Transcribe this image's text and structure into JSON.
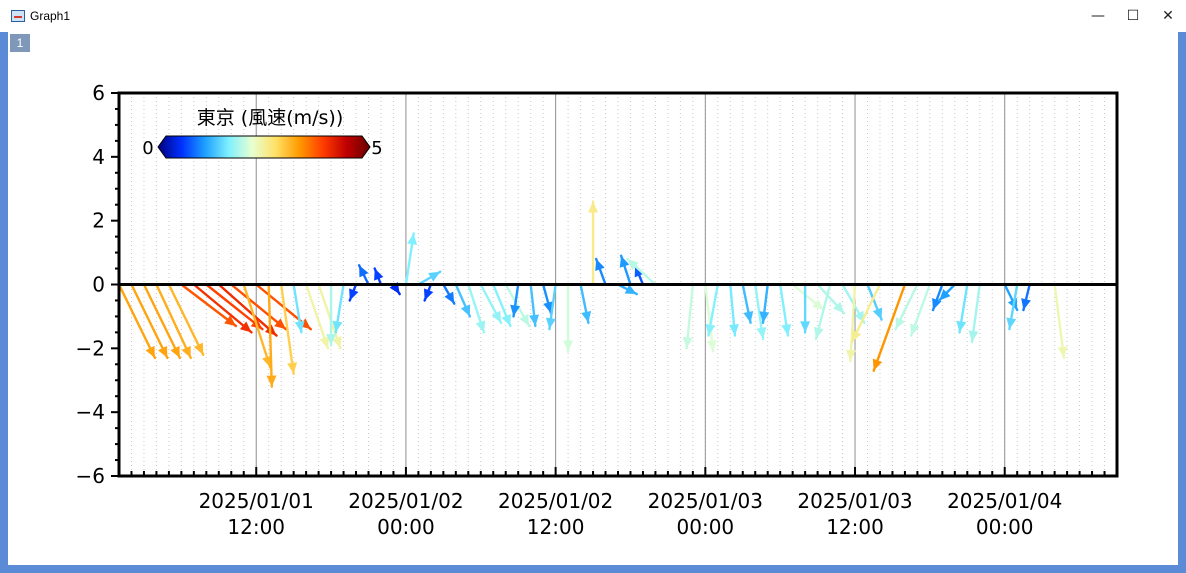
{
  "window": {
    "title": "Graph1",
    "layer_label": "1",
    "minimize": "—",
    "maximize": "☐",
    "close": "✕"
  },
  "chart_data": {
    "type": "vector",
    "title": "",
    "xlabel": "",
    "ylabel": "",
    "x_axis": {
      "ticks": [
        "2025/01/01\n12:00",
        "2025/01/02\n00:00",
        "2025/01/02\n12:00",
        "2025/01/03\n00:00",
        "2025/01/03\n12:00",
        "2025/01/04\n00:00"
      ],
      "tick_hours": [
        12,
        24,
        36,
        48,
        60,
        72
      ],
      "range_hours": [
        1,
        81
      ],
      "minor_step_hours": 1
    },
    "y_axis": {
      "range": [
        -6,
        6
      ],
      "ticks": [
        -6,
        -4,
        -2,
        0,
        2,
        4,
        6
      ],
      "minor_step": 0.5
    },
    "grid": true,
    "colormap": {
      "title": "東京 (風速(m/s))",
      "min_label": "0",
      "max_label": "5",
      "range": [
        0,
        5
      ],
      "colors": [
        "#00007f",
        "#0030ff",
        "#1ea0ff",
        "#7ff0ff",
        "#e8ffd0",
        "#ffe066",
        "#ff9a00",
        "#ff3c00",
        "#c00000",
        "#6a0000"
      ],
      "placement": "top-left"
    },
    "vectors": [
      {
        "t": 1,
        "u": 2.3,
        "v": -2.3
      },
      {
        "t": 2,
        "u": 2.3,
        "v": -2.3
      },
      {
        "t": 3,
        "u": 2.3,
        "v": -2.3
      },
      {
        "t": 4,
        "u": 2.2,
        "v": -2.3
      },
      {
        "t": 5,
        "u": 2.2,
        "v": -2.2
      },
      {
        "t": 6,
        "u": 3.5,
        "v": -1.3
      },
      {
        "t": 7,
        "u": 3.7,
        "v": -1.5
      },
      {
        "t": 8,
        "u": 3.6,
        "v": -1.4
      },
      {
        "t": 9,
        "u": 3.7,
        "v": -1.6
      },
      {
        "t": 10,
        "u": 3.5,
        "v": -1.4
      },
      {
        "t": 11,
        "u": 1.7,
        "v": -2.6
      },
      {
        "t": 12,
        "u": 3.5,
        "v": -1.4
      },
      {
        "t": 13,
        "u": 0.2,
        "v": -3.2
      },
      {
        "t": 14,
        "u": 0.8,
        "v": -2.8
      },
      {
        "t": 15,
        "u": 0.5,
        "v": -1.5
      },
      {
        "t": 16,
        "u": 1.4,
        "v": -2.0
      },
      {
        "t": 17,
        "u": 1.4,
        "v": -2.0
      },
      {
        "t": 18,
        "u": 0.0,
        "v": -1.9
      },
      {
        "t": 19,
        "u": -0.5,
        "v": -1.5
      },
      {
        "t": 20,
        "u": -0.4,
        "v": -0.5
      },
      {
        "t": 21,
        "u": -0.6,
        "v": 0.6
      },
      {
        "t": 22,
        "u": -0.4,
        "v": 0.5
      },
      {
        "t": 23,
        "u": 0.4,
        "v": -0.3
      },
      {
        "t": 24,
        "u": 0.5,
        "v": 1.6
      },
      {
        "t": 25,
        "u": 1.4,
        "v": 0.4
      },
      {
        "t": 26,
        "u": -0.4,
        "v": -0.5
      },
      {
        "t": 27,
        "u": 0.7,
        "v": -0.6
      },
      {
        "t": 28,
        "u": 0.9,
        "v": -1.0
      },
      {
        "t": 29,
        "u": 1.0,
        "v": -1.5
      },
      {
        "t": 30,
        "u": 1.3,
        "v": -1.2
      },
      {
        "t": 31,
        "u": 1.1,
        "v": -1.3
      },
      {
        "t": 32,
        "u": 1.5,
        "v": -1.3
      },
      {
        "t": 33,
        "u": -0.3,
        "v": -1.0
      },
      {
        "t": 34,
        "u": 0.3,
        "v": -1.3
      },
      {
        "t": 35,
        "u": 0.5,
        "v": -0.9
      },
      {
        "t": 36,
        "u": -0.4,
        "v": -1.4
      },
      {
        "t": 37,
        "u": 0.0,
        "v": -2.1
      },
      {
        "t": 38,
        "u": 0.5,
        "v": -1.2
      },
      {
        "t": 39,
        "u": 0.0,
        "v": 2.6
      },
      {
        "t": 40,
        "u": -0.6,
        "v": 0.8
      },
      {
        "t": 41,
        "u": 1.2,
        "v": -0.3
      },
      {
        "t": 42,
        "u": -0.6,
        "v": 0.9
      },
      {
        "t": 43,
        "u": -0.5,
        "v": 0.6
      },
      {
        "t": 44,
        "u": -1.8,
        "v": 0.8
      },
      {
        "t": 45,
        "u": 0.0,
        "v": 0.0
      },
      {
        "t": 46,
        "u": 0.0,
        "v": 0.0
      },
      {
        "t": 47,
        "u": -0.4,
        "v": -2.0
      },
      {
        "t": 48,
        "u": 0.5,
        "v": -2.1
      },
      {
        "t": 49,
        "u": -0.6,
        "v": -1.6
      },
      {
        "t": 50,
        "u": 0.3,
        "v": -1.6
      },
      {
        "t": 51,
        "u": 0.5,
        "v": -1.2
      },
      {
        "t": 52,
        "u": 0.5,
        "v": -1.7
      },
      {
        "t": 53,
        "u": -0.3,
        "v": -1.2
      },
      {
        "t": 54,
        "u": 0.5,
        "v": -1.6
      },
      {
        "t": 55,
        "u": 2.0,
        "v": -0.8
      },
      {
        "t": 56,
        "u": 0.0,
        "v": -1.5
      },
      {
        "t": 57,
        "u": 1.7,
        "v": -0.9
      },
      {
        "t": 58,
        "u": -0.9,
        "v": -1.7
      },
      {
        "t": 59,
        "u": 1.4,
        "v": -1.2
      },
      {
        "t": 60,
        "u": -0.3,
        "v": -2.4
      },
      {
        "t": 61,
        "u": 0.9,
        "v": -1.1
      },
      {
        "t": 62,
        "u": -1.8,
        "v": -1.8
      },
      {
        "t": 63,
        "u": 0.0,
        "v": 0.0
      },
      {
        "t": 64,
        "u": -2.0,
        "v": -2.7
      },
      {
        "t": 65,
        "u": -1.4,
        "v": -1.4
      },
      {
        "t": 66,
        "u": -1.2,
        "v": -1.6
      },
      {
        "t": 67,
        "u": -0.6,
        "v": -0.8
      },
      {
        "t": 68,
        "u": -1.0,
        "v": -0.5
      },
      {
        "t": 69,
        "u": -0.5,
        "v": -1.5
      },
      {
        "t": 70,
        "u": -0.5,
        "v": -1.8
      },
      {
        "t": 71,
        "u": 0.0,
        "v": 0.0
      },
      {
        "t": 72,
        "u": 0.8,
        "v": -0.8
      },
      {
        "t": 73,
        "u": -0.5,
        "v": -1.4
      },
      {
        "t": 74,
        "u": -0.4,
        "v": -0.8
      },
      {
        "t": 75,
        "u": 0.0,
        "v": 0.0
      },
      {
        "t": 76,
        "u": 0.6,
        "v": -2.3
      },
      {
        "t": 77,
        "u": 0.0,
        "v": 0.0
      },
      {
        "t": 78,
        "u": 0.0,
        "v": 0.0
      },
      {
        "t": 79,
        "u": 0.0,
        "v": 0.0
      },
      {
        "t": 80,
        "u": 0.0,
        "v": 0.0
      }
    ]
  }
}
